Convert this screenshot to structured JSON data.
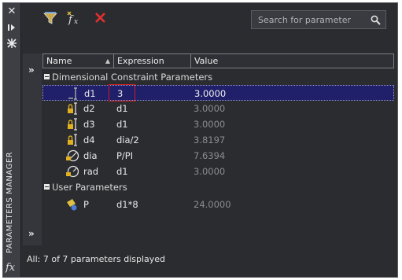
{
  "strip": {
    "title": "PARAMETERS MANAGER",
    "fx": "fx",
    "close_icon": "close-icon",
    "autohide_icon": "autohide-icon",
    "properties_icon": "properties-icon"
  },
  "toolbar": {
    "search_placeholder": "Search for parameter",
    "icons": [
      "filter-icon",
      "new-user-parameter-icon",
      "delete-icon",
      "search-icon"
    ]
  },
  "columns": [
    "Name",
    "Expression",
    "Value"
  ],
  "groups": [
    {
      "label": "Dimensional Constraint Parameters",
      "rows": [
        {
          "name": "d1",
          "expression": "3",
          "value": "3.0000",
          "selected": true,
          "icon": "linear-dimension-icon"
        },
        {
          "name": "d2",
          "expression": "d1",
          "value": "3.0000",
          "icon": "lock-dimension-icon"
        },
        {
          "name": "d3",
          "expression": "d1",
          "value": "3.0000",
          "icon": "lock-dimension-icon"
        },
        {
          "name": "d4",
          "expression": "dia/2",
          "value": "3.8197",
          "icon": "lock-dimension-icon"
        },
        {
          "name": "dia",
          "expression": "P/PI",
          "value": "7.6394",
          "icon": "diameter-icon"
        },
        {
          "name": "rad",
          "expression": "d1",
          "value": "3.0000",
          "icon": "radius-icon"
        }
      ]
    },
    {
      "label": "User Parameters",
      "rows": [
        {
          "name": "P",
          "expression": "d1*8",
          "value": "24.0000",
          "icon": "user-parameter-icon"
        }
      ]
    }
  ],
  "status": "All: 7 of 7 parameters displayed",
  "colors": {
    "selection": "#1f1f6a",
    "highlight_box": "#d02020",
    "panel": "#2b2c30"
  }
}
